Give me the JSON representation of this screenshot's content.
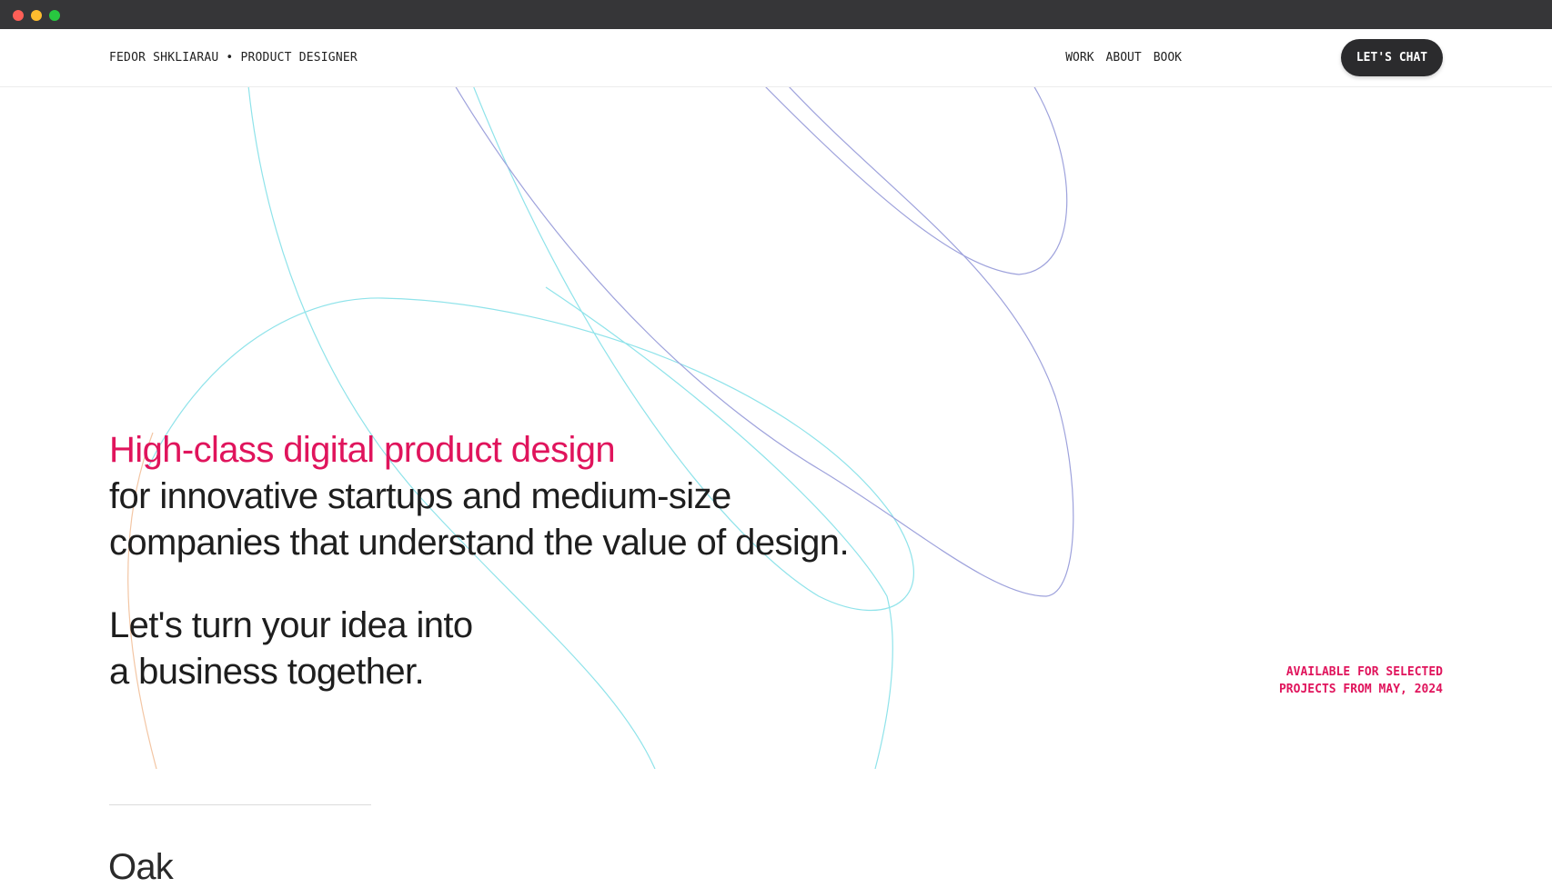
{
  "window": {
    "controls": [
      "close",
      "minimize",
      "zoom"
    ]
  },
  "header": {
    "brand": "FEDOR SHKLIARAU • PRODUCT DESIGNER",
    "nav": [
      {
        "label": "WORK"
      },
      {
        "label": "ABOUT"
      },
      {
        "label": "BOOK"
      }
    ],
    "cta_label": "LET'S CHAT"
  },
  "hero": {
    "headline_accent": "High-class digital product design",
    "headline_lines": [
      "for innovative startups and medium-size",
      "companies that understand the value of design."
    ],
    "subline_lines": [
      "Let's turn your idea into",
      "a business together."
    ]
  },
  "availability": {
    "lines": [
      "AVAILABLE FOR SELECTED",
      "PROJECTS FROM MAY, 2024"
    ]
  },
  "next_section": {
    "title": "Oak"
  },
  "colors": {
    "accent": "#e0145c",
    "cta_bg": "#2b2b2d",
    "curve_cyan": "#8fe3ea",
    "curve_violet": "#9ea2dc",
    "curve_peach": "#f3c6a4"
  }
}
